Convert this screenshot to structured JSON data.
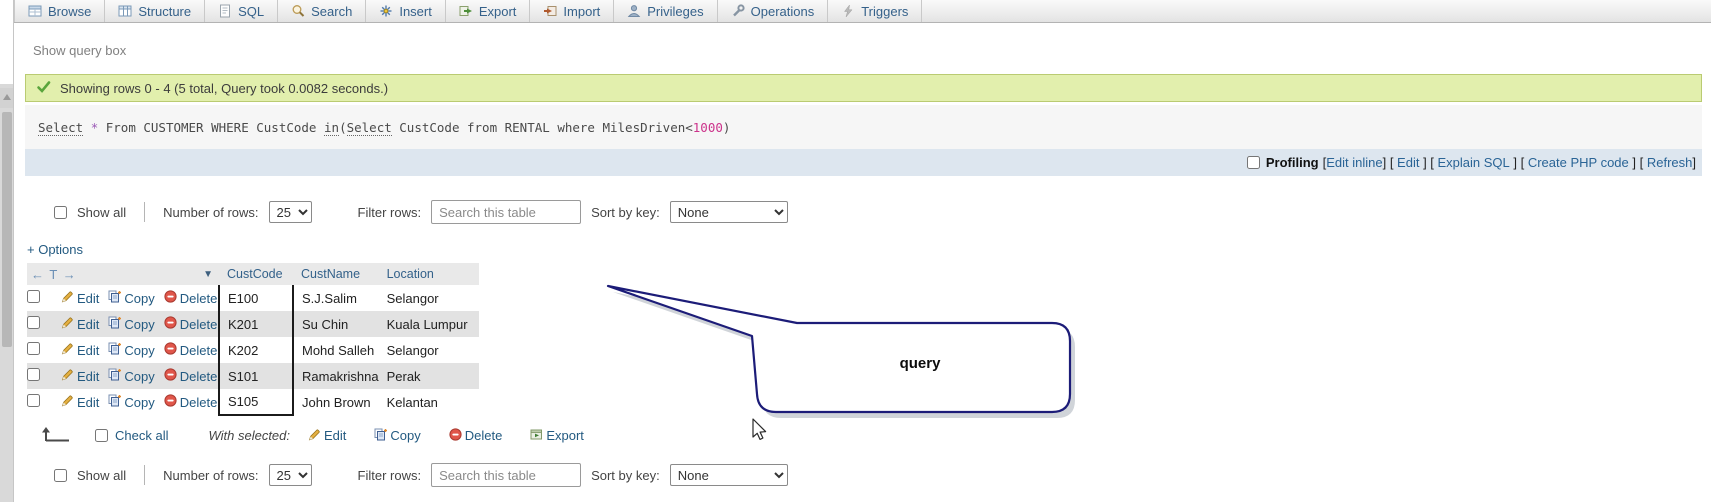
{
  "tabs": [
    {
      "label": "Browse",
      "icon": "browse-icon"
    },
    {
      "label": "Structure",
      "icon": "structure-icon"
    },
    {
      "label": "SQL",
      "icon": "sql-icon"
    },
    {
      "label": "Search",
      "icon": "search-icon"
    },
    {
      "label": "Insert",
      "icon": "insert-icon"
    },
    {
      "label": "Export",
      "icon": "export-icon"
    },
    {
      "label": "Import",
      "icon": "import-icon"
    },
    {
      "label": "Privileges",
      "icon": "privileges-icon"
    },
    {
      "label": "Operations",
      "icon": "operations-icon"
    },
    {
      "label": "Triggers",
      "icon": "triggers-icon"
    }
  ],
  "query_box": {
    "link": "Show query box"
  },
  "message": {
    "text": "Showing rows 0 - 4 (5 total, Query took 0.0082 seconds.)"
  },
  "sql": {
    "tokens": [
      "Select",
      " ",
      "*",
      " From CUSTOMER WHERE CustCode ",
      "in",
      "(",
      "Select",
      " CustCode from RENTAL where MilesDriven",
      "<",
      "1000",
      ")"
    ]
  },
  "profiling": {
    "seq": [
      "Profiling",
      "[",
      "Edit inline",
      "] [ ",
      "Edit",
      " ] [ ",
      "Explain SQL",
      " ] [ ",
      "Create PHP code",
      " ] [ ",
      "Refresh",
      "]"
    ]
  },
  "controls": {
    "show_all": "Show all",
    "num_rows_label": "Number of rows:",
    "num_rows_value": "25",
    "filter_label": "Filter rows:",
    "filter_placeholder": "Search this table",
    "sort_label": "Sort by key:",
    "sort_value": "None"
  },
  "options": {
    "link": "+ Options"
  },
  "table": {
    "header": {
      "arrows": "← T →",
      "sort_icon": "▼",
      "columns": [
        "CustCode",
        "CustName",
        "Location"
      ]
    },
    "actions": {
      "edit": "Edit",
      "copy": "Copy",
      "delete": "Delete"
    },
    "rows": [
      {
        "custcode": "E100",
        "custname": "S.J.Salim",
        "location": "Selangor"
      },
      {
        "custcode": "K201",
        "custname": "Su Chin",
        "location": "Kuala Lumpur"
      },
      {
        "custcode": "K202",
        "custname": "Mohd Salleh",
        "location": "Selangor"
      },
      {
        "custcode": "S101",
        "custname": "Ramakrishna",
        "location": "Perak"
      },
      {
        "custcode": "S105",
        "custname": "John Brown",
        "location": "Kelantan"
      }
    ]
  },
  "footer": {
    "check_all": "Check all",
    "with_selected": "With selected:",
    "edit": "Edit",
    "copy": "Copy",
    "delete": "Delete",
    "export": "Export"
  },
  "callout": {
    "text": "query"
  },
  "colors": {
    "link": "#235a81",
    "success_bg": "#e2efad",
    "profiling_bg": "#dde6ef",
    "callout_border": "#1c1c78",
    "annotation_box": "#1b1b1b"
  }
}
